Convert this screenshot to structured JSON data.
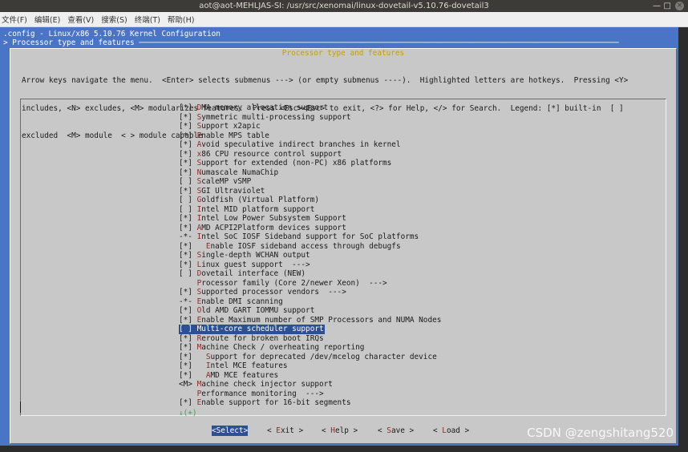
{
  "window": {
    "title": "aot@aot-MEHLJAS-SI: /usr/src/xenomai/linux-dovetail-v5.10.76-dovetail3",
    "minimize": "—",
    "maximize": "□",
    "close": "×"
  },
  "menubar": [
    "文件(F)",
    "编辑(E)",
    "查看(V)",
    "搜索(S)",
    "终端(T)",
    "帮助(H)"
  ],
  "terminal": {
    "header_line": ".config - Linux/x86 5.10.76 Kernel Configuration",
    "breadcrumb_line": "> Processor type and features ──────────────────────────────────────────────────────────────────────────────────────────────────────────"
  },
  "dialog": {
    "title": "Processor type and features",
    "help_lines": [
      "Arrow keys navigate the menu.  <Enter> selects submenus ---> (or empty submenus ----).  Highlighted letters are hotkeys.  Pressing <Y>",
      "includes, <N> excludes, <M> modularizes features.  Press <Esc><Esc> to exit, <?> for Help, </> for Search.  Legend: [*] built-in  [ ]",
      "excluded  <M> module  < > module capable"
    ],
    "items": [
      {
        "prefix": "[*] ",
        "hotkey": "D",
        "rest": "MA memory allocation support"
      },
      {
        "prefix": "[*] ",
        "hotkey": "S",
        "rest": "ymmetric multi-processing support"
      },
      {
        "prefix": "[*] ",
        "hotkey": "S",
        "rest": "upport x2apic"
      },
      {
        "prefix": "[*] ",
        "hotkey": "E",
        "rest": "nable MPS table"
      },
      {
        "prefix": "[*] ",
        "hotkey": "A",
        "rest": "void speculative indirect branches in kernel"
      },
      {
        "prefix": "[*] ",
        "hotkey": "x",
        "rest": "86 CPU resource control support"
      },
      {
        "prefix": "[*] ",
        "hotkey": "S",
        "rest": "upport for extended (non-PC) x86 platforms"
      },
      {
        "prefix": "[*] ",
        "hotkey": "N",
        "rest": "umascale NumaChip"
      },
      {
        "prefix": "[ ] ",
        "hotkey": "S",
        "rest": "caleMP vSMP"
      },
      {
        "prefix": "[*] ",
        "hotkey": "S",
        "rest": "GI Ultraviolet"
      },
      {
        "prefix": "[ ] ",
        "hotkey": "G",
        "rest": "oldfish (Virtual Platform)"
      },
      {
        "prefix": "[ ] ",
        "hotkey": "I",
        "rest": "ntel MID platform support"
      },
      {
        "prefix": "[*] ",
        "hotkey": "I",
        "rest": "ntel Low Power Subsystem Support"
      },
      {
        "prefix": "[*] ",
        "hotkey": "A",
        "rest": "MD ACPI2Platform devices support"
      },
      {
        "prefix": "-*- ",
        "hotkey": "I",
        "rest": "ntel SoC IOSF Sideband support for SoC platforms"
      },
      {
        "prefix": "[*]   ",
        "hotkey": "E",
        "rest": "nable IOSF sideband access through debugfs"
      },
      {
        "prefix": "[*] ",
        "hotkey": "S",
        "rest": "ingle-depth WCHAN output"
      },
      {
        "prefix": "[*] ",
        "hotkey": "L",
        "rest": "inux guest support  --->"
      },
      {
        "prefix": "[ ] ",
        "hotkey": "D",
        "rest": "ovetail interface (NEW)"
      },
      {
        "prefix": "    ",
        "hotkey": "P",
        "rest": "rocessor family (Core 2/newer Xeon)  --->"
      },
      {
        "prefix": "[*] ",
        "hotkey": "S",
        "rest": "upported processor vendors  --->"
      },
      {
        "prefix": "-*- ",
        "hotkey": "E",
        "rest": "nable DMI scanning"
      },
      {
        "prefix": "[*] ",
        "hotkey": "O",
        "rest": "ld AMD GART IOMMU support"
      },
      {
        "prefix": "[*] ",
        "hotkey": "E",
        "rest": "nable Maximum number of SMP Processors and NUMA Nodes"
      },
      {
        "prefix": "[ ] ",
        "hotkey": "M",
        "rest": "ulti-core scheduler support"
      },
      {
        "prefix": "[*] ",
        "hotkey": "R",
        "rest": "eroute for broken boot IRQs"
      },
      {
        "prefix": "[*] ",
        "hotkey": "M",
        "rest": "achine Check / overheating reporting"
      },
      {
        "prefix": "[*]   ",
        "hotkey": "S",
        "rest": "upport for deprecated /dev/mcelog character device"
      },
      {
        "prefix": "[*]   ",
        "hotkey": "I",
        "rest": "ntel MCE features"
      },
      {
        "prefix": "[*]   ",
        "hotkey": "A",
        "rest": "MD MCE features"
      },
      {
        "prefix": "<M> ",
        "hotkey": "M",
        "rest": "achine check injector support"
      },
      {
        "prefix": "    ",
        "hotkey": "P",
        "rest": "erformance monitoring  --->"
      },
      {
        "prefix": "[*] ",
        "hotkey": "E",
        "rest": "nable support for 16-bit segments"
      }
    ],
    "selected_index": 24,
    "more_indicator": "↓(+)",
    "buttons": [
      {
        "label": "<Select>",
        "hotkey": "",
        "active": true
      },
      {
        "label": "< Exit >",
        "hotkey": "E",
        "active": false
      },
      {
        "label": "< Help >",
        "hotkey": "H",
        "active": false
      },
      {
        "label": "< Save >",
        "hotkey": "S",
        "active": false
      },
      {
        "label": "< Load >",
        "hotkey": "L",
        "active": false
      }
    ]
  },
  "watermark": "CSDN @zengshitang520",
  "colors": {
    "terminal_bg": "#4a74c6",
    "dialog_bg": "#c8c8c8",
    "title_yellow": "#c4a000",
    "hotkey_red": "#8f2a2a",
    "selection_blue": "#2d4f93",
    "more_green": "#3aa64a"
  }
}
